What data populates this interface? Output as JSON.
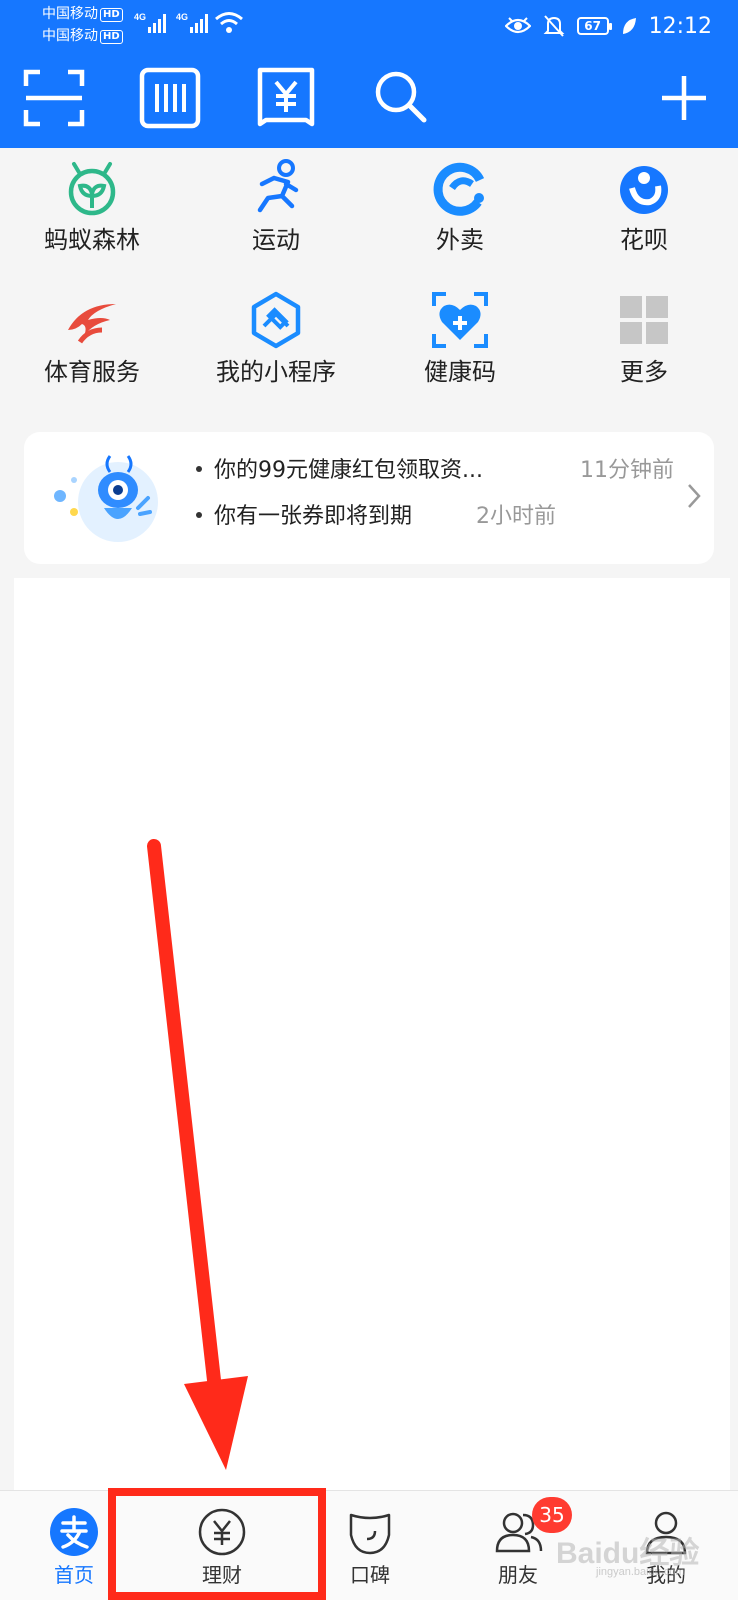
{
  "status_bar": {
    "carrier_1": "中国移动",
    "carrier_2": "中国移动",
    "hd": "HD",
    "network_type": "4G",
    "battery": "67",
    "time": "12:12"
  },
  "toolbar": {
    "icons": [
      "scan-icon",
      "payment-code-icon",
      "bill-icon",
      "search-icon",
      "add-icon"
    ]
  },
  "grid": {
    "items": [
      {
        "label": "蚂蚁森林",
        "icon": "ant-forest-icon"
      },
      {
        "label": "运动",
        "icon": "sport-icon"
      },
      {
        "label": "外卖",
        "icon": "takeout-icon"
      },
      {
        "label": "花呗",
        "icon": "huabei-icon"
      },
      {
        "label": "体育服务",
        "icon": "sports-service-icon"
      },
      {
        "label": "我的小程序",
        "icon": "mini-program-icon"
      },
      {
        "label": "健康码",
        "icon": "health-code-icon"
      },
      {
        "label": "更多",
        "icon": "more-icon"
      }
    ]
  },
  "notice": {
    "items": [
      {
        "text": "你的99元健康红包领取资...",
        "time": "11分钟前"
      },
      {
        "text": "你有一张券即将到期",
        "time": "2小时前"
      }
    ]
  },
  "bottom_nav": {
    "items": [
      {
        "label": "首页",
        "icon": "alipay-home-icon",
        "active": true
      },
      {
        "label": "理财",
        "icon": "wealth-icon",
        "active": false
      },
      {
        "label": "口碑",
        "icon": "koubei-icon",
        "active": false
      },
      {
        "label": "朋友",
        "icon": "friends-icon",
        "active": false,
        "badge": "35"
      },
      {
        "label": "我的",
        "icon": "profile-icon",
        "active": false
      }
    ]
  },
  "watermark": {
    "brand": "Baidu经验",
    "url": "jingyan.baidu.com"
  },
  "colors": {
    "brand_blue": "#1677ff",
    "annotation_red": "#ff2a1a",
    "badge_red": "#ff3b30"
  }
}
